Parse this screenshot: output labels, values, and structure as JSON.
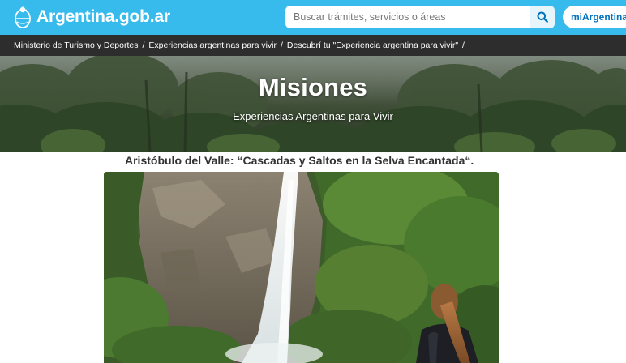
{
  "header": {
    "site_title": "Argentina.gob.ar",
    "search_placeholder": "Buscar trámites, servicios o áreas",
    "account_button": "miArgentina",
    "bar_color": "#37bbed"
  },
  "breadcrumb": {
    "items": [
      "Ministerio de Turismo y Deportes",
      "Experiencias argentinas para vivir",
      "Descubrí tu \"Experiencia argentina para vivir\""
    ],
    "separator": "/"
  },
  "hero": {
    "title": "Misiones",
    "subtitle": "Experiencias Argentinas para Vivir"
  },
  "article": {
    "title": "Aristóbulo del Valle: “Cascadas y Saltos en la Selva Encantada“."
  }
}
